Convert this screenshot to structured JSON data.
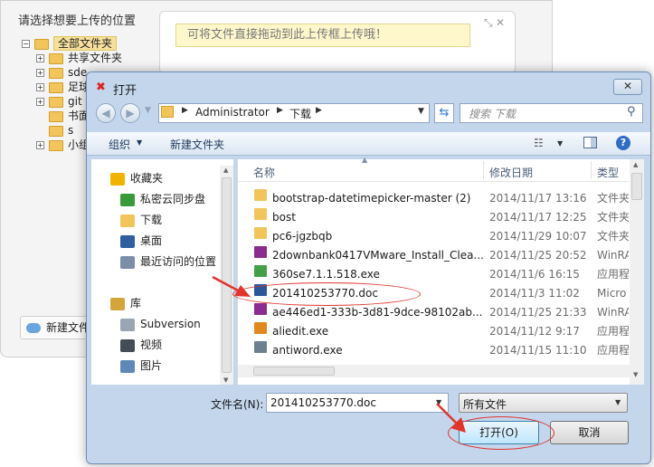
{
  "background_page": {
    "heading": "请选择想要上传的位置",
    "tree": [
      {
        "label": "全部文件夹",
        "selected": true
      },
      {
        "label": "共享文件夹"
      },
      {
        "label": "sde"
      },
      {
        "label": "足球"
      },
      {
        "label": "git"
      },
      {
        "label": "书面"
      },
      {
        "label": "s"
      },
      {
        "label": "小组"
      }
    ],
    "drop_hint": "可将文件直接拖动到此上传框上传哦！",
    "new_folder_button": "新建文件",
    "shrink_glyph": "⤡",
    "close_glyph": "✕"
  },
  "dialog": {
    "title": "打开",
    "title_icon": "✖",
    "close_glyph": "✕",
    "address": {
      "crumbs": [
        "Administrator",
        "下载"
      ]
    },
    "search_placeholder": "搜索 下载",
    "toolbar": {
      "organize": "组织",
      "new_folder": "新建文件夹"
    },
    "nav_pane": {
      "items": [
        {
          "label": "收藏夹",
          "icon": "star-icon",
          "color": "#f0b400"
        },
        {
          "label": "私密云同步盘",
          "icon": "cloud-sync-icon",
          "color": "#3a9a3a"
        },
        {
          "label": "下载",
          "icon": "download-folder-icon",
          "color": "#f2c55c"
        },
        {
          "label": "桌面",
          "icon": "desktop-icon",
          "color": "#2f5f9e"
        },
        {
          "label": "最近访问的位置",
          "icon": "recent-places-icon",
          "color": "#7a8ea8"
        },
        {
          "label": "库",
          "icon": "library-icon",
          "color": "#d6a53a"
        },
        {
          "label": "Subversion",
          "icon": "library-doc-icon",
          "color": "#9aa6b4"
        },
        {
          "label": "视频",
          "icon": "video-icon",
          "color": "#444c58"
        },
        {
          "label": "图片",
          "icon": "pictures-icon",
          "color": "#5d88b8"
        }
      ]
    },
    "columns": {
      "name": "名称",
      "date": "修改日期",
      "type": "类型"
    },
    "files": [
      {
        "name": "bootstrap-datetimepicker-master (2)",
        "date": "2014/11/17 13:16",
        "type": "文件夹",
        "icon": "folder-icon",
        "color": "#f2c55c"
      },
      {
        "name": "bost",
        "date": "2014/11/17 12:25",
        "type": "文件夹",
        "icon": "folder-icon",
        "color": "#f2c55c"
      },
      {
        "name": "pc6-jgzbqb",
        "date": "2014/11/29 10:07",
        "type": "文件夹",
        "icon": "folder-icon",
        "color": "#f2c55c"
      },
      {
        "name": "2downbank0417VMware_Install_Clea...",
        "date": "2014/11/25 20:52",
        "type": "WinRA",
        "icon": "winrar-icon",
        "color": "#8b2c8f"
      },
      {
        "name": "360se7.1.1.518.exe",
        "date": "2014/11/6 16:15",
        "type": "应用程",
        "icon": "360-browser-icon",
        "color": "#43a047"
      },
      {
        "name": "201410253770.doc",
        "date": "2014/11/3 11:02",
        "type": "Micro",
        "icon": "word-doc-icon",
        "color": "#2b579a"
      },
      {
        "name": "ae446ed1-333b-3d81-9dce-98102ab...",
        "date": "2014/11/25 21:33",
        "type": "WinRA",
        "icon": "winrar-icon",
        "color": "#8b2c8f"
      },
      {
        "name": "aliedit.exe",
        "date": "2014/11/12 9:17",
        "type": "应用程",
        "icon": "shield-app-icon",
        "color": "#e08a1e"
      },
      {
        "name": "antiword.exe",
        "date": "2014/11/15 11:10",
        "type": "应用程",
        "icon": "exe-icon",
        "color": "#6f7f92"
      }
    ],
    "filename_label": "文件名(N):",
    "filename_value": "201410253770.doc",
    "filetype_value": "所有文件",
    "open_button": "打开(O)",
    "cancel_button": "取消"
  },
  "colors": {
    "annotation_red": "#e0342c",
    "dialog_frame": "#c3d6ec"
  }
}
